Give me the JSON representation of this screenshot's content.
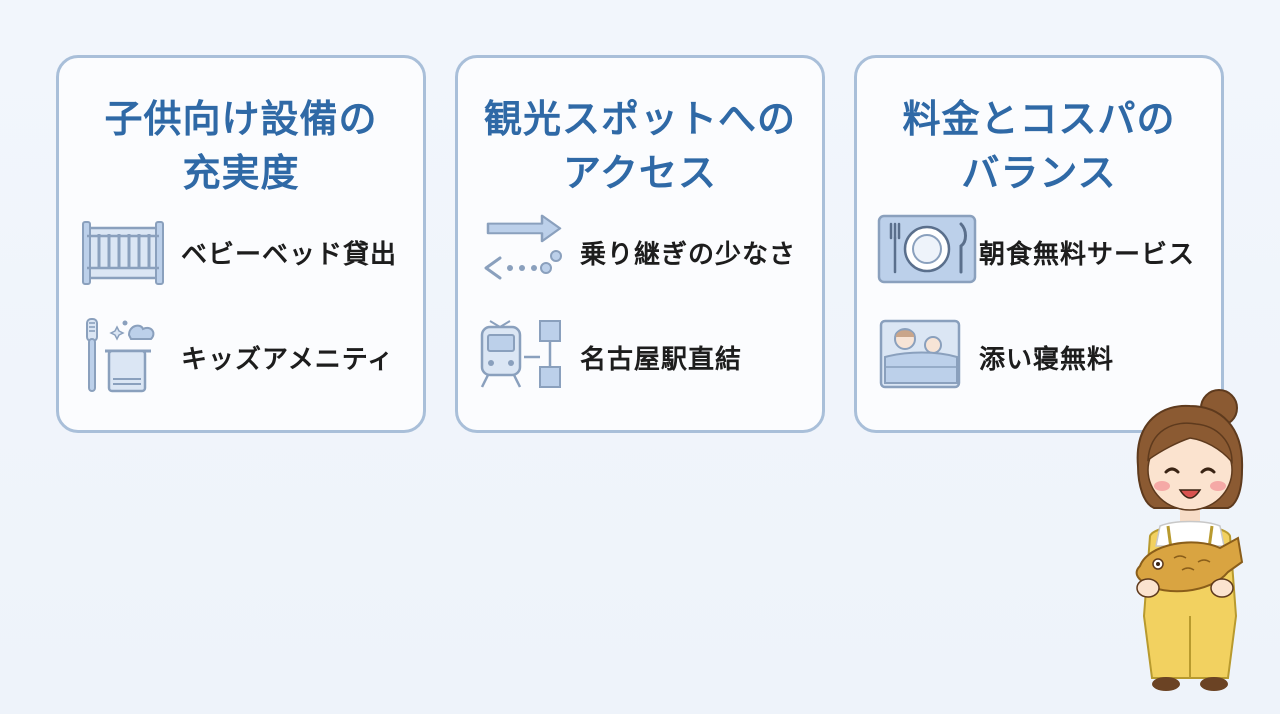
{
  "cards": [
    {
      "title_lines": [
        "子供向け設備の",
        "充実度"
      ],
      "features": [
        {
          "icon": "baby-crib-icon",
          "label": "ベビーベッド貸出"
        },
        {
          "icon": "toothbrush-towel-icon",
          "label": "キッズアメニティ"
        }
      ]
    },
    {
      "title_lines": [
        "観光スポットへの",
        "アクセス"
      ],
      "features": [
        {
          "icon": "transfer-arrows-icon",
          "label": "乗り継ぎの少なさ"
        },
        {
          "icon": "train-station-icon",
          "label": "名古屋駅直結"
        }
      ]
    },
    {
      "title_lines": [
        "料金とコスパの",
        "バランス"
      ],
      "features": [
        {
          "icon": "plate-cutlery-icon",
          "label": "朝食無料サービス"
        },
        {
          "icon": "co-sleeping-icon",
          "label": "添い寝無料"
        }
      ]
    }
  ],
  "colors": {
    "accent": "#2f69a6",
    "card_border": "#a9bfd9",
    "icon_fill": "#bcd0ea",
    "icon_stroke": "#8aa0bd"
  }
}
